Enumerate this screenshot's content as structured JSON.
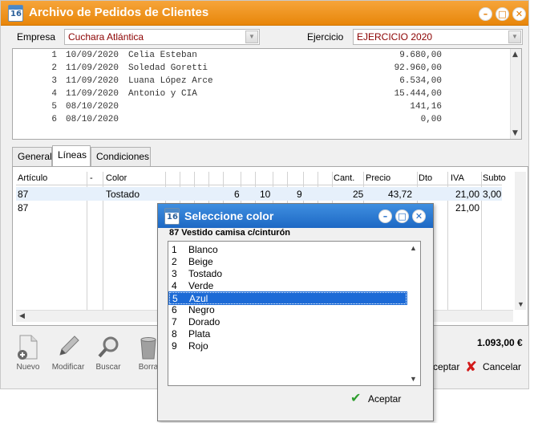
{
  "window": {
    "title": "Archivo de Pedidos de Clientes",
    "icon_label": "16"
  },
  "empresa": {
    "label": "Empresa",
    "value": "Cuchara Atlántica"
  },
  "ejercicio": {
    "label": "Ejercicio",
    "value": "EJERCICIO 2020"
  },
  "orders": [
    {
      "num": "1",
      "date": "10/09/2020",
      "client": "Celia Esteban",
      "amount": "9.680,00"
    },
    {
      "num": "2",
      "date": "11/09/2020",
      "client": "Soledad Goretti",
      "amount": "92.960,00"
    },
    {
      "num": "3",
      "date": "11/09/2020",
      "client": "Luana López Arce",
      "amount": "6.534,00"
    },
    {
      "num": "4",
      "date": "11/09/2020",
      "client": "Antonio y CIA",
      "amount": "15.444,00"
    },
    {
      "num": "5",
      "date": "08/10/2020",
      "client": "",
      "amount": "141,16"
    },
    {
      "num": "6",
      "date": "08/10/2020",
      "client": "",
      "amount": "0,00"
    }
  ],
  "tabs": [
    "General",
    "Líneas",
    "Condiciones"
  ],
  "grid": {
    "headers": {
      "articulo": "Artículo",
      "dash": "-",
      "color": "Color",
      "cant": "Cant.",
      "precio": "Precio",
      "dto": "Dto",
      "iva": "IVA",
      "subtotal": "Subto"
    },
    "rows": [
      {
        "articulo": "87",
        "color": "Tostado",
        "c1": "6",
        "c2": "10",
        "c3": "9",
        "cant": "25",
        "precio": "43,72",
        "iva": "21,00",
        "subtotal": "3,00"
      },
      {
        "articulo": "87",
        "color": "",
        "c1": "",
        "c2": "",
        "c3": "",
        "cant": "",
        "precio": "",
        "iva": "21,00",
        "subtotal": ""
      }
    ]
  },
  "toolbar": {
    "nuevo": "Nuevo",
    "modificar": "Modificar",
    "buscar": "Buscar",
    "borrar": "Borra"
  },
  "total": "1.093,00 €",
  "actions": {
    "aceptar_partial": "ceptar",
    "cancelar": "Cancelar"
  },
  "dialog": {
    "title": "Seleccione color",
    "subtitle": "87 Vestido camisa c/cinturón",
    "colors": [
      {
        "n": "1",
        "label": "Blanco"
      },
      {
        "n": "2",
        "label": "Beige"
      },
      {
        "n": "3",
        "label": "Tostado"
      },
      {
        "n": "4",
        "label": "Verde"
      },
      {
        "n": "5",
        "label": "Azul"
      },
      {
        "n": "6",
        "label": "Negro"
      },
      {
        "n": "7",
        "label": "Dorado"
      },
      {
        "n": "8",
        "label": "Plata"
      },
      {
        "n": "9",
        "label": "Rojo"
      }
    ],
    "selected_index": 4,
    "accept_label": "Aceptar"
  },
  "colors": {
    "title_orange": "#f39a26",
    "dialog_blue": "#1d68c4",
    "selection": "#1c6ad6",
    "field_text": "#8b0000"
  }
}
